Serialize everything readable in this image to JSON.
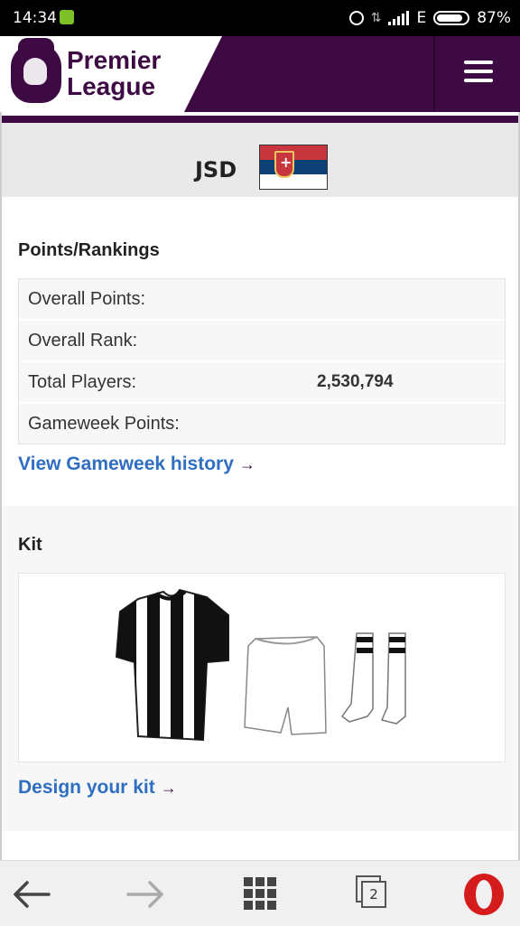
{
  "status": {
    "time": "14:34",
    "network": "E",
    "battery": "87%"
  },
  "header": {
    "brand_line1": "Premier",
    "brand_line2": "League"
  },
  "team": {
    "name": "JSD"
  },
  "points": {
    "title": "Points/Rankings",
    "rows": [
      {
        "label": "Overall Points:",
        "value": ""
      },
      {
        "label": "Overall Rank:",
        "value": ""
      },
      {
        "label": "Total Players:",
        "value": "2,530,794"
      },
      {
        "label": "Gameweek Points:",
        "value": ""
      }
    ],
    "history_link": "View Gameweek history"
  },
  "kit": {
    "title": "Kit",
    "design_link": "Design your kit"
  },
  "browser": {
    "tab_count": "2"
  },
  "colors": {
    "brand": "#3d0a44",
    "link": "#2f6ec0",
    "flag_red": "#c6363c",
    "flag_blue": "#0c4077"
  }
}
